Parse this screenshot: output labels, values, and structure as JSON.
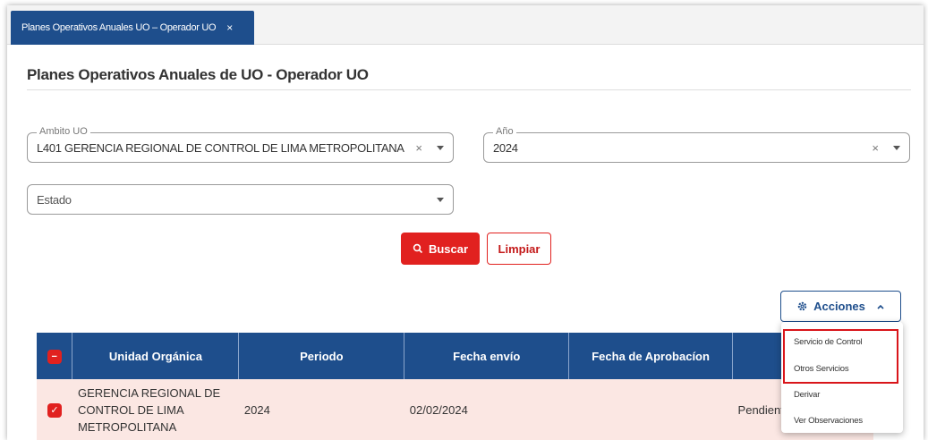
{
  "tab": {
    "label": "Planes Operativos Anuales UO – Operador UO",
    "close": "×"
  },
  "page": {
    "title": "Planes Operativos Anuales de UO - Operador UO"
  },
  "filters": {
    "ambito": {
      "label": "Ambito UO",
      "value": "L401 GERENCIA REGIONAL DE CONTROL DE LIMA METROPOLITANA",
      "clear": "×"
    },
    "anio": {
      "label": "Año",
      "value": "2024",
      "clear": "×"
    },
    "estado": {
      "placeholder": "Estado"
    }
  },
  "buttons": {
    "buscar": "Buscar",
    "limpiar": "Limpiar",
    "acciones": "Acciones"
  },
  "icons": {
    "search": "search-icon",
    "gear": "gear-icon",
    "chevron_up": "chevron-up-icon",
    "check": "check-icon",
    "minus": "minus-icon"
  },
  "table": {
    "headers": [
      "Unidad Orgánica",
      "Periodo",
      "Fecha envío",
      "Fecha de Aprobacíon",
      ""
    ],
    "rows": [
      {
        "unidad": [
          "GERENCIA REGIONAL DE",
          "CONTROL DE LIMA",
          "METROPOLITANA"
        ],
        "periodo": "2024",
        "fecha_envio": "02/02/2024",
        "fecha_aprobacion": "",
        "estado": "Pendient"
      }
    ]
  },
  "menu": {
    "items": [
      "Servicio de Control",
      "Otros Servicios",
      "Derivar",
      "Ver Observaciones"
    ]
  },
  "colors": {
    "primary_blue": "#1e4e8c",
    "accent_red": "#e1211f",
    "row_selected": "#fbe7e3"
  }
}
